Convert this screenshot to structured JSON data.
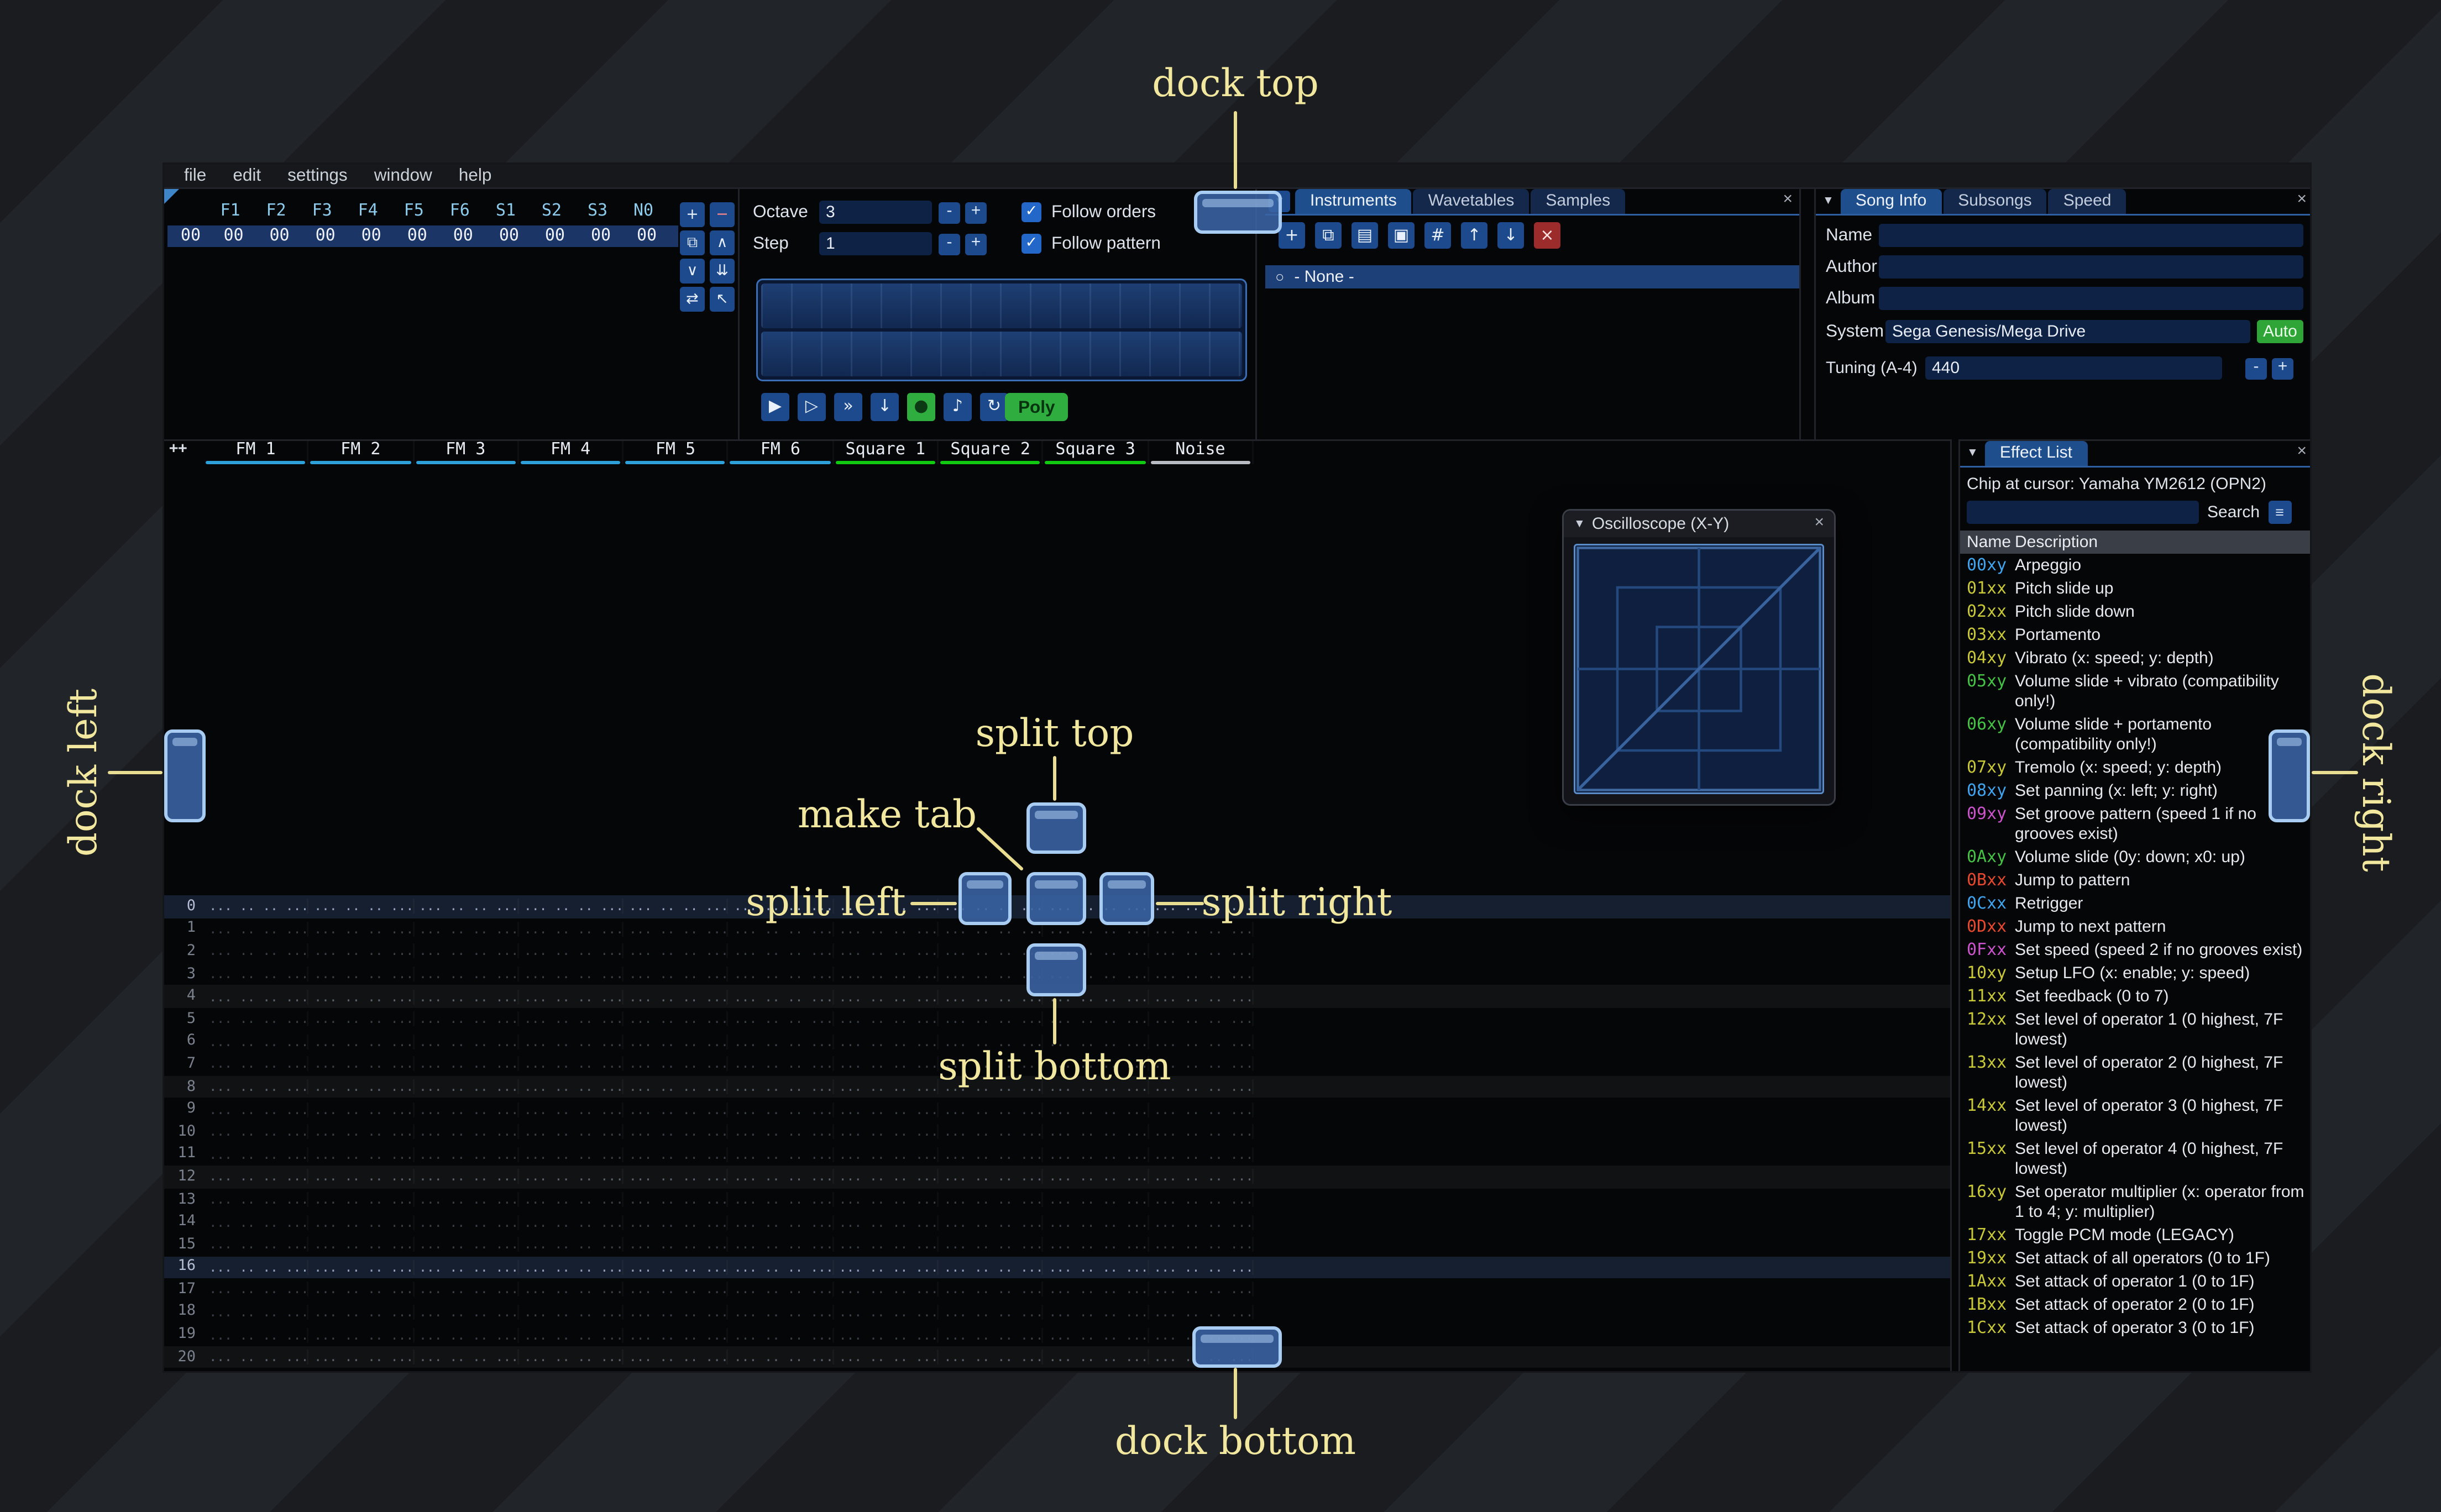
{
  "ui": {
    "close_glyph": "×",
    "collapse_glyph": "▼",
    "check_glyph": "✓",
    "hamburger_glyph": "≡"
  },
  "annotations": {
    "dock_top": "dock top",
    "dock_bottom": "dock bottom",
    "dock_left": "dock left",
    "dock_right": "dock right",
    "split_top": "split top",
    "split_bottom": "split bottom",
    "split_left": "split left",
    "split_right": "split right",
    "make_tab": "make tab"
  },
  "menu_bar": {
    "items": [
      "file",
      "edit",
      "settings",
      "window",
      "help"
    ]
  },
  "orders": {
    "columns": [
      "F1",
      "F2",
      "F3",
      "F4",
      "F5",
      "F6",
      "S1",
      "S2",
      "S3",
      "N0"
    ],
    "row_index": "00",
    "row_values": [
      "00",
      "00",
      "00",
      "00",
      "00",
      "00",
      "00",
      "00",
      "00",
      "00"
    ],
    "buttons": [
      {
        "name": "add",
        "glyph": "+"
      },
      {
        "name": "remove",
        "glyph": "−",
        "danger": true
      },
      {
        "name": "duplicate",
        "glyph": "⧉"
      },
      {
        "name": "move-up",
        "glyph": "∧"
      },
      {
        "name": "move-down",
        "glyph": "∨"
      },
      {
        "name": "duplicate-to-end",
        "glyph": "⇊"
      },
      {
        "name": "change-all",
        "glyph": "⇄"
      },
      {
        "name": "edit-mode",
        "glyph": "↖"
      }
    ]
  },
  "controls": {
    "octave_label": "Octave",
    "octave_value": "3",
    "step_label": "Step",
    "step_value": "1",
    "minus": "-",
    "plus": "+",
    "follow_orders": "Follow orders",
    "follow_pattern": "Follow pattern",
    "poly_label": "Poly",
    "transport": [
      {
        "name": "play",
        "glyph": "▶"
      },
      {
        "name": "play-pattern",
        "glyph": "▷"
      },
      {
        "name": "fast-forward",
        "glyph": "»"
      },
      {
        "name": "step-down",
        "glyph": "↓"
      },
      {
        "name": "record",
        "glyph": "●",
        "green": true
      },
      {
        "name": "metronome",
        "glyph": "♪"
      },
      {
        "name": "repeat-pattern",
        "glyph": "↻"
      }
    ]
  },
  "instruments_panel": {
    "tabs": [
      {
        "label": "Instruments",
        "active": true
      },
      {
        "label": "Wavetables",
        "active": false
      },
      {
        "label": "Samples",
        "active": false
      }
    ],
    "toolbar": [
      {
        "name": "add",
        "glyph": "+"
      },
      {
        "name": "duplicate",
        "glyph": "⧉"
      },
      {
        "name": "open",
        "glyph": "▤"
      },
      {
        "name": "save",
        "glyph": "▣"
      },
      {
        "name": "toggle-folders",
        "glyph": "#"
      },
      {
        "name": "move-up",
        "glyph": "↑"
      },
      {
        "name": "move-down",
        "glyph": "↓"
      },
      {
        "name": "delete",
        "glyph": "×",
        "danger": true
      }
    ],
    "items": [
      {
        "icon": "○",
        "label": "- None -",
        "selected": true
      }
    ]
  },
  "song_info": {
    "tabs": [
      {
        "label": "Song Info",
        "active": true
      },
      {
        "label": "Subsongs",
        "active": false
      },
      {
        "label": "Speed",
        "active": false
      }
    ],
    "fields": [
      {
        "label": "Name",
        "value": ""
      },
      {
        "label": "Author",
        "value": ""
      },
      {
        "label": "Album",
        "value": ""
      }
    ],
    "system": {
      "label": "System",
      "value": "Sega Genesis/Mega Drive",
      "auto_label": "Auto"
    },
    "tuning": {
      "label": "Tuning (A-4)",
      "value": "440"
    }
  },
  "pattern": {
    "expand_label": "++",
    "empty_cell": "... .. .. ....",
    "row_count": 22,
    "highlight_major": [
      0,
      16
    ],
    "highlight_minor": [
      4,
      8,
      12,
      20
    ],
    "channels": [
      {
        "name": "FM 1",
        "type": "fm"
      },
      {
        "name": "FM 2",
        "type": "fm"
      },
      {
        "name": "FM 3",
        "type": "fm"
      },
      {
        "name": "FM 4",
        "type": "fm"
      },
      {
        "name": "FM 5",
        "type": "fm"
      },
      {
        "name": "FM 6",
        "type": "fm"
      },
      {
        "name": "Square 1",
        "type": "square"
      },
      {
        "name": "Square 2",
        "type": "square"
      },
      {
        "name": "Square 3",
        "type": "square"
      },
      {
        "name": "Noise",
        "type": "noise"
      }
    ]
  },
  "oscilloscope": {
    "title": "Oscilloscope (X-Y)"
  },
  "effect_list": {
    "tab_label": "Effect List",
    "chip_line": "Chip at cursor: Yamaha YM2612 (OPN2)",
    "search_label": "Search",
    "header": {
      "name": "Name",
      "description": "Description"
    },
    "effects": [
      {
        "code": "00xy",
        "desc": "Arpeggio",
        "color": "blue",
        "lines": 1
      },
      {
        "code": "01xx",
        "desc": "Pitch slide up",
        "color": "yellow",
        "lines": 1
      },
      {
        "code": "02xx",
        "desc": "Pitch slide down",
        "color": "yellow",
        "lines": 1
      },
      {
        "code": "03xx",
        "desc": "Portamento",
        "color": "yellow",
        "lines": 1
      },
      {
        "code": "04xy",
        "desc": "Vibrato (x: speed; y: depth)",
        "color": "yellow",
        "lines": 1
      },
      {
        "code": "05xy",
        "desc": "Volume slide + vibrato (compatibility only!)",
        "color": "green",
        "lines": 2
      },
      {
        "code": "06xy",
        "desc": "Volume slide + portamento (compatibility only!)",
        "color": "green",
        "lines": 2
      },
      {
        "code": "07xy",
        "desc": "Tremolo (x: speed; y: depth)",
        "color": "yellow",
        "lines": 1
      },
      {
        "code": "08xy",
        "desc": "Set panning (x: left; y: right)",
        "color": "blue",
        "lines": 1
      },
      {
        "code": "09xy",
        "desc": "Set groove pattern (speed 1 if no grooves exist)",
        "color": "magenta",
        "lines": 2
      },
      {
        "code": "0Axy",
        "desc": "Volume slide (0y: down; x0: up)",
        "color": "green",
        "lines": 1
      },
      {
        "code": "0Bxx",
        "desc": "Jump to pattern",
        "color": "red",
        "lines": 1
      },
      {
        "code": "0Cxx",
        "desc": "Retrigger",
        "color": "blue",
        "lines": 1
      },
      {
        "code": "0Dxx",
        "desc": "Jump to next pattern",
        "color": "red",
        "lines": 1
      },
      {
        "code": "0Fxx",
        "desc": "Set speed (speed 2 if no grooves exist)",
        "color": "magenta",
        "lines": 1
      },
      {
        "code": "10xy",
        "desc": "Setup LFO (x: enable; y: speed)",
        "color": "yellow",
        "lines": 1
      },
      {
        "code": "11xx",
        "desc": "Set feedback (0 to 7)",
        "color": "yellow",
        "lines": 1
      },
      {
        "code": "12xx",
        "desc": "Set level of operator 1 (0 highest, 7F lowest)",
        "color": "yellow",
        "lines": 2
      },
      {
        "code": "13xx",
        "desc": "Set level of operator 2 (0 highest, 7F lowest)",
        "color": "yellow",
        "lines": 2
      },
      {
        "code": "14xx",
        "desc": "Set level of operator 3 (0 highest, 7F lowest)",
        "color": "yellow",
        "lines": 2
      },
      {
        "code": "15xx",
        "desc": "Set level of operator 4 (0 highest, 7F lowest)",
        "color": "yellow",
        "lines": 2
      },
      {
        "code": "16xy",
        "desc": "Set operator multiplier (x: operator from 1 to 4; y: multiplier)",
        "color": "yellow",
        "lines": 2
      },
      {
        "code": "17xx",
        "desc": "Toggle PCM mode (LEGACY)",
        "color": "yellow",
        "lines": 1
      },
      {
        "code": "19xx",
        "desc": "Set attack of all operators (0 to 1F)",
        "color": "yellow",
        "lines": 1
      },
      {
        "code": "1Axx",
        "desc": "Set attack of operator 1 (0 to 1F)",
        "color": "yellow",
        "lines": 1
      },
      {
        "code": "1Bxx",
        "desc": "Set attack of operator 2 (0 to 1F)",
        "color": "yellow",
        "lines": 1
      },
      {
        "code": "1Cxx",
        "desc": "Set attack of operator 3 (0 to 1F)",
        "color": "yellow",
        "lines": 1
      }
    ]
  },
  "colors": {
    "fm_channel": "#2d9fd9",
    "square_channel": "#12c912",
    "noise_channel": "#b8bcc2",
    "annotation_text": "#f1e79e",
    "annotation_line": "#e9dd92",
    "dock_fill": "rgba(58,100,165,0.88)",
    "dock_border": "#a9cdf2",
    "accent_green": "#2fae3f"
  }
}
